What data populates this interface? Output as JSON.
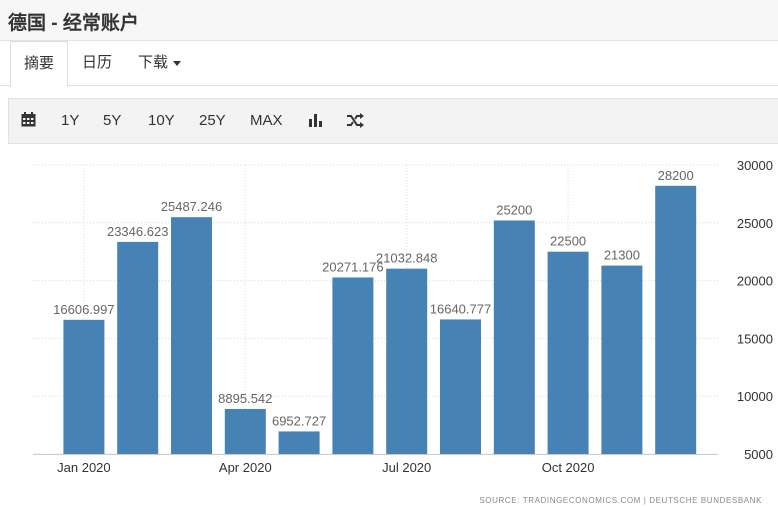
{
  "header": {
    "title": "德国 - 经常账户"
  },
  "tabs": [
    {
      "label": "摘要"
    },
    {
      "label": "日历"
    },
    {
      "label": "下载"
    }
  ],
  "toolbar": {
    "icons": [
      "calendar-icon",
      "bar-chart-icon",
      "shuffle-icon"
    ],
    "ranges": [
      "1Y",
      "5Y",
      "10Y",
      "25Y",
      "MAX"
    ]
  },
  "colors": {
    "bar": "#4682b4",
    "grid": "#d9d9d9",
    "label": "#666666"
  },
  "chart_data": {
    "type": "bar",
    "title": "",
    "xlabel": "",
    "ylabel": "",
    "categories": [
      "2020-01",
      "2020-02",
      "2020-03",
      "2020-04",
      "2020-05",
      "2020-06",
      "2020-07",
      "2020-08",
      "2020-09",
      "2020-10",
      "2020-11",
      "2020-12"
    ],
    "values": [
      16606.997,
      23346.623,
      25487.246,
      8895.542,
      6952.727,
      20271.176,
      21032.848,
      16640.777,
      25200,
      22500,
      21300,
      28200
    ],
    "value_labels": [
      "16606.997",
      "23346.623",
      "25487.246",
      "8895.542",
      "6952.727",
      "20271.176",
      "21032.848",
      "16640.777",
      "25200",
      "22500",
      "21300",
      "28200"
    ],
    "x_tick_labels": [
      {
        "label": "Jan 2020",
        "category": "2020-01"
      },
      {
        "label": "Apr 2020",
        "category": "2020-04"
      },
      {
        "label": "Jul 2020",
        "category": "2020-07"
      },
      {
        "label": "Oct 2020",
        "category": "2020-10"
      }
    ],
    "y_ticks": [
      5000,
      10000,
      15000,
      20000,
      25000,
      30000
    ],
    "ylim": [
      5000,
      30000
    ],
    "y_axis_side": "right",
    "grid": true,
    "legend": "none"
  },
  "footer": {
    "source": "SOURCE: TRADINGECONOMICS.COM  |  DEUTSCHE BUNDESBANK"
  }
}
